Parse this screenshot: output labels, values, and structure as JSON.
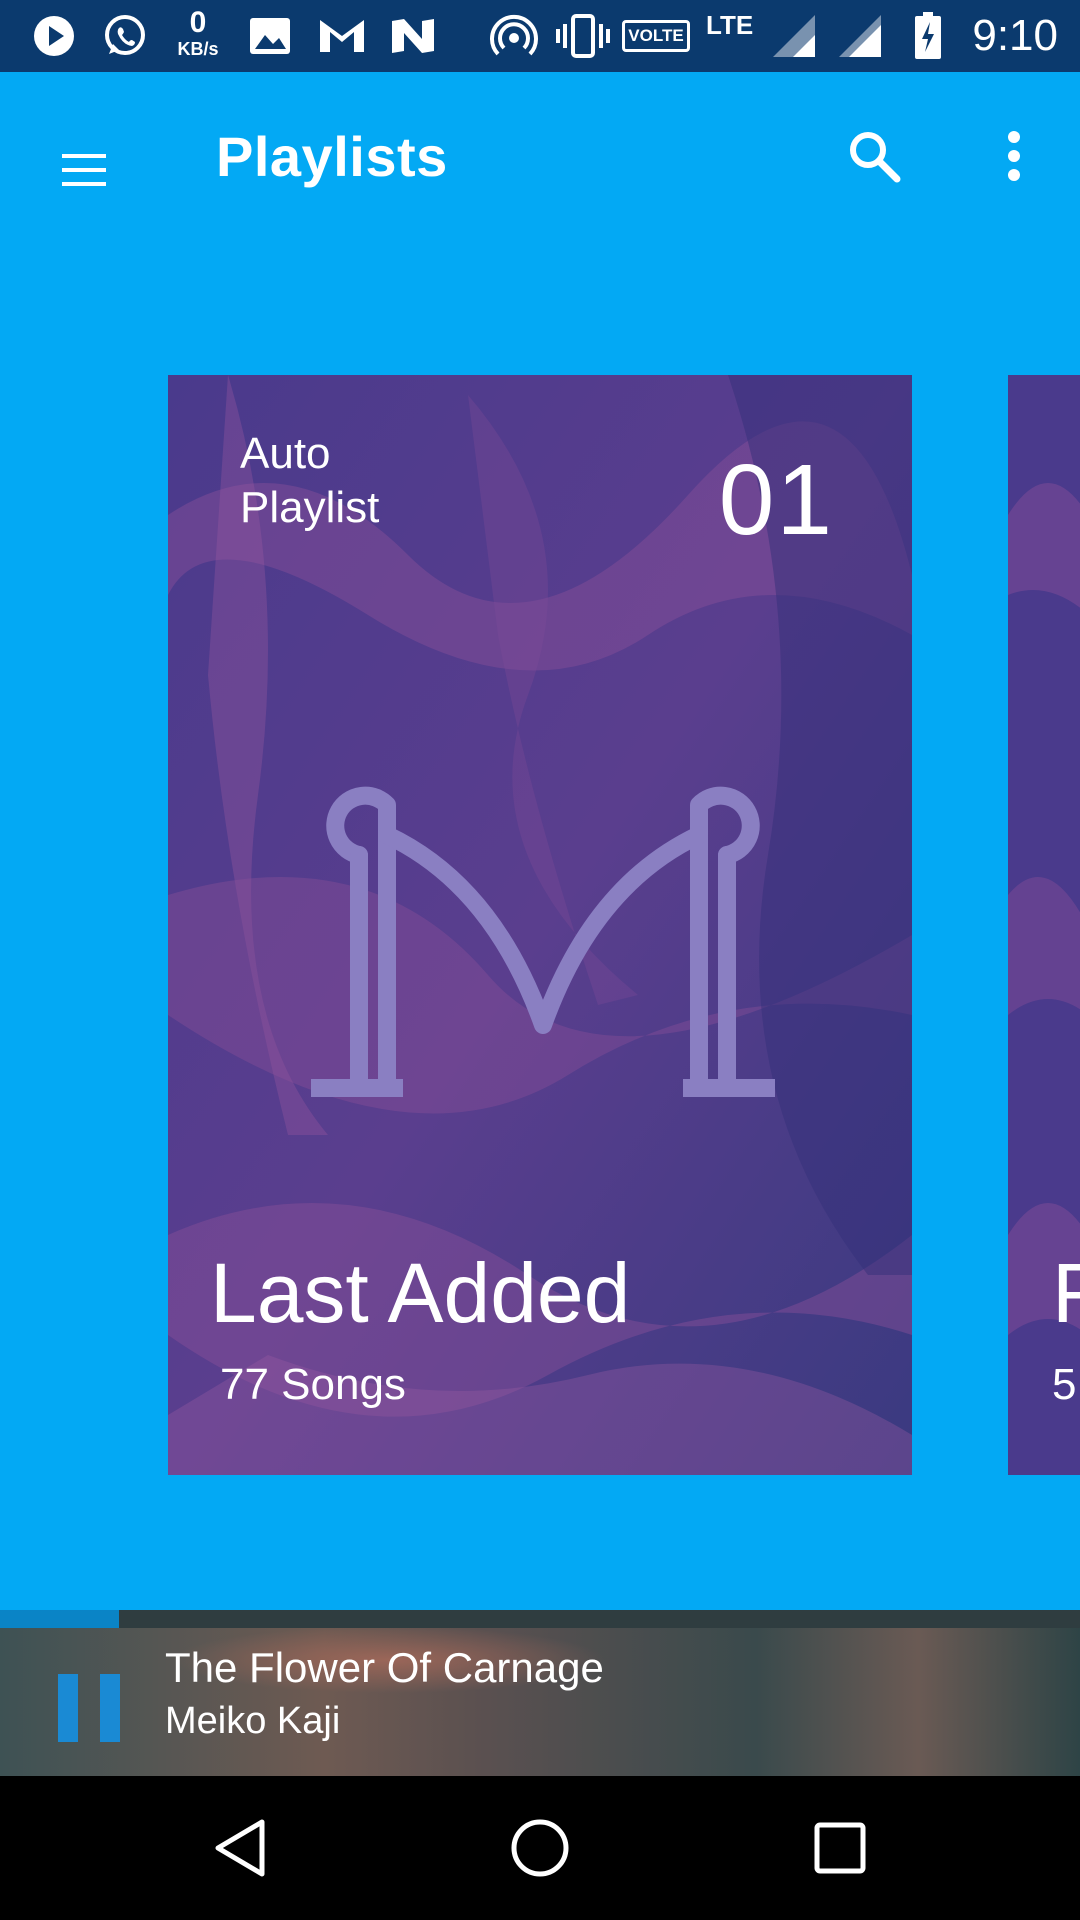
{
  "status_bar": {
    "time": "9:10",
    "network_speed_value": "0",
    "network_speed_unit": "KB/s",
    "volte_label": "VOLTE",
    "lte_label": "LTE",
    "icons": [
      "play-notification-icon",
      "whatsapp-icon",
      "gallery-icon",
      "gmail-m-icon",
      "n-app-icon",
      "hotspot-icon",
      "vibrate-icon",
      "signal-icon",
      "signal-icon",
      "battery-charging-icon"
    ]
  },
  "toolbar": {
    "title": "Playlists",
    "icons": [
      "menu-icon",
      "search-icon",
      "more-vert-icon"
    ]
  },
  "playlist_card": {
    "kicker_line1": "Auto",
    "kicker_line2": "Playlist",
    "number": "01",
    "title": "Last Added",
    "subtitle": "77 Songs"
  },
  "next_card_peek": {
    "title_initial": "F",
    "subtitle_initial": "5"
  },
  "now_playing": {
    "title": "The Flower Of Carnage",
    "artist": "Meiko Kaji",
    "progress": 0.11
  },
  "nav_bar": {
    "icons": [
      "back-icon",
      "home-icon",
      "recents-icon"
    ]
  },
  "colors": {
    "accent": "#03A9F4",
    "status_bar": "#0B3A6E",
    "card_overlay": "#3C3A82",
    "logo": "#8A7FC2",
    "progress": "#0A84C6"
  }
}
